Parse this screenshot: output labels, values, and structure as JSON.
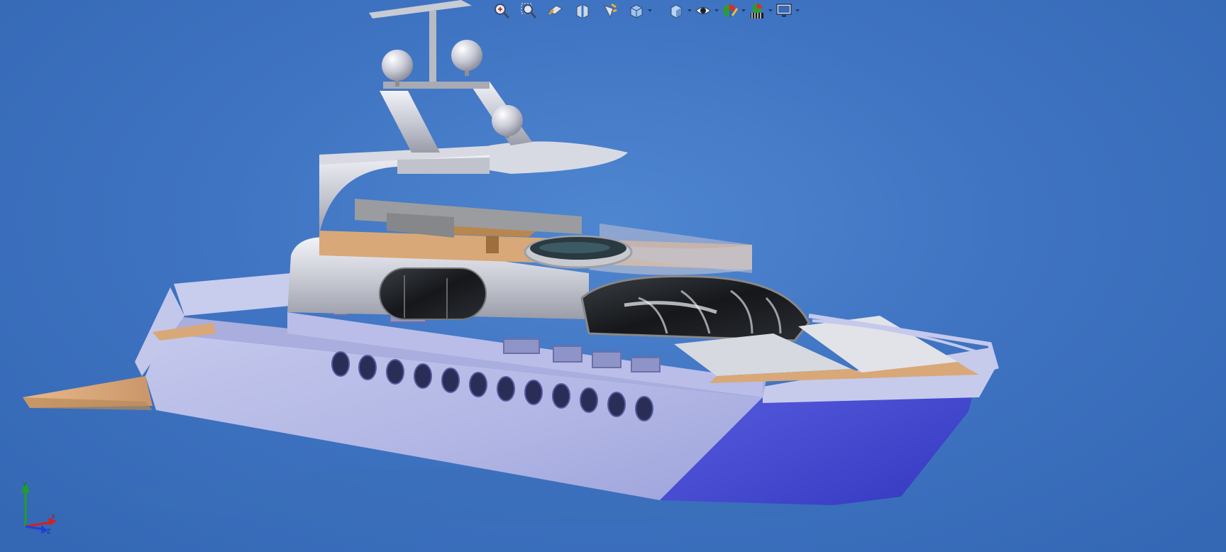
{
  "viewport": {
    "background_top": "#4f86d0",
    "background_bottom": "#3367b4"
  },
  "heads_up_toolbar": {
    "buttons": [
      {
        "name": "zoom-to-fit",
        "icon": "zoom-to-fit-icon"
      },
      {
        "name": "zoom-to-area",
        "icon": "zoom-to-area-icon"
      },
      {
        "name": "previous-view",
        "icon": "previous-view-icon"
      },
      {
        "name": "section-view",
        "icon": "section-view-icon"
      },
      {
        "name": "dynamic-annotation-views",
        "icon": "annotation-view-icon"
      },
      {
        "name": "view-orientation",
        "icon": "view-orientation-icon"
      },
      {
        "name": "display-style",
        "icon": "display-style-icon"
      },
      {
        "name": "hide-show-items",
        "icon": "eye-icon"
      },
      {
        "name": "edit-appearance",
        "icon": "appearance-icon"
      },
      {
        "name": "apply-scene",
        "icon": "scene-icon"
      },
      {
        "name": "view-settings",
        "icon": "monitor-icon"
      }
    ]
  },
  "triad": {
    "x_label": "X",
    "y_label": "Y",
    "z_label": "Z",
    "x_color": "#d42020",
    "y_color": "#20a020",
    "z_color": "#2040d0"
  },
  "model": {
    "hull_color": "#b7bde6",
    "hull_shadow": "#4a4fd0",
    "deck_color": "#d9a878",
    "glass_color": "#1f2226"
  }
}
